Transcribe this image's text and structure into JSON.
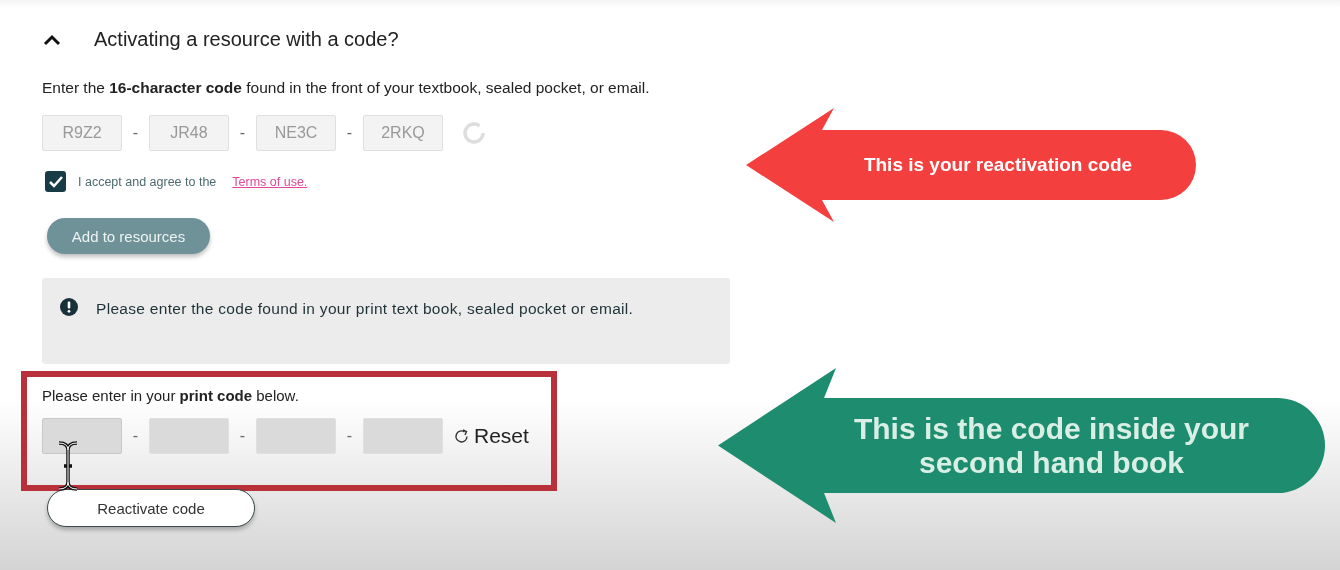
{
  "section": {
    "title": "Activating a resource with a code?",
    "expanded": true
  },
  "instructions": "Enter the **16-character code** found in the front of your textbook, sealed pocket, or email.",
  "code_fields": [
    {
      "value": "R9Z2"
    },
    {
      "value": "JR48"
    },
    {
      "value": "NE3C"
    },
    {
      "value": "2RKQ"
    }
  ],
  "code_separators": [
    "-",
    "-",
    "-"
  ],
  "terms": {
    "checked": true,
    "label": "I accept and agree to the",
    "link": "Terms of use."
  },
  "add_button": {
    "label": "Add to resources"
  },
  "notice": "Please enter the code found in your print text book, sealed pocket or email.",
  "print_code": {
    "prompt": "Please enter in your **print code** below.",
    "fields": [
      {
        "focused": true
      },
      {
        "focused": false
      },
      {
        "focused": false
      },
      {
        "focused": false
      }
    ],
    "separators": [
      "-",
      "-",
      "-"
    ],
    "reset_label": "Reset"
  },
  "reactivate_button": {
    "label": "Reactivate code"
  },
  "annotations": [
    {
      "text": "This is your reactivation code",
      "color": "#f43f3f"
    },
    {
      "text": "This is the code inside your second hand book",
      "color": "#1e8c6e"
    }
  ]
}
